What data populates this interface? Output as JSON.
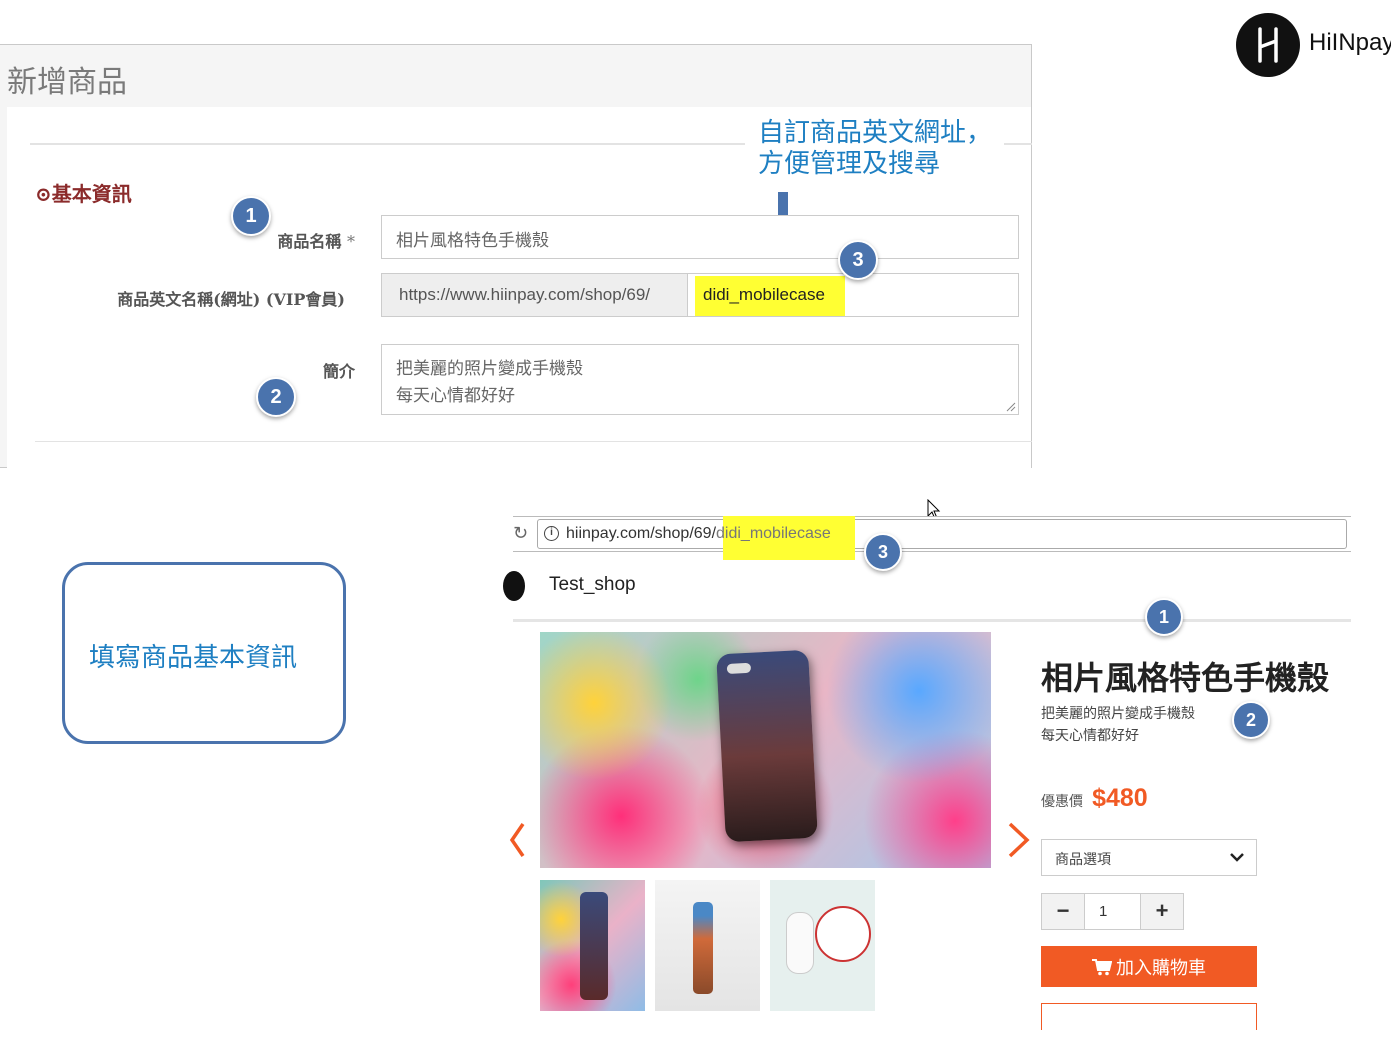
{
  "brand": {
    "name": "HiINpay"
  },
  "admin_form": {
    "title": "新增商品",
    "section_title": "⊙基本資訊",
    "annotation": {
      "line1": "自訂商品英文網址，",
      "line2": "方便管理及搜尋"
    },
    "name_label": "商品名稱",
    "required_mark": "*",
    "name_value": "相片風格特色手機殼",
    "url_label": "商品英文名稱(網址) (VIP會員)",
    "url_prefix": "https://www.hiinpay.com/shop/69/",
    "url_slug": "didi_mobilecase",
    "intro_label": "簡介",
    "intro_line1": "把美麗的照片變成手機殼",
    "intro_line2": "每天心情都好好"
  },
  "callout": {
    "text": "填寫商品基本資訊"
  },
  "browser": {
    "url_base": "hiinpay.com/shop/69/",
    "url_slug": "didi_mobilecase"
  },
  "shop": {
    "name": "Test_shop",
    "product_title": "相片風格特色手機殼",
    "desc_line1": "把美麗的照片變成手機殼",
    "desc_line2": "每天心情都好好",
    "price_label": "優惠價",
    "price": "$480",
    "option_placeholder": "商品選項",
    "quantity": "1",
    "add_to_cart": "加入購物車"
  },
  "badges": {
    "one": "1",
    "two": "2",
    "three": "3"
  },
  "colors": {
    "accent_orange": "#f15a24",
    "badge_blue": "#4a73ad",
    "highlight_yellow": "#ffff33",
    "annotation_blue": "#1e7fc2",
    "section_red": "#8b2b2b"
  }
}
